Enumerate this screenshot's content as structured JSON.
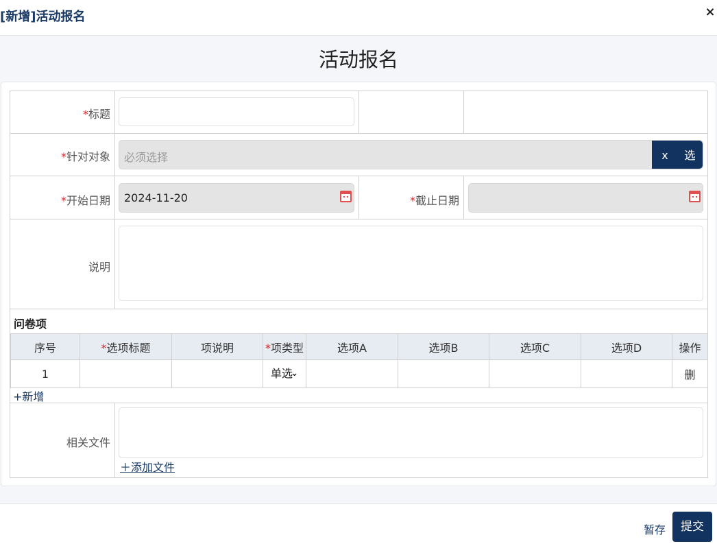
{
  "dialog": {
    "title": "[新增]活动报名",
    "close_label": "×"
  },
  "form": {
    "heading": "活动报名",
    "required_mark": "*",
    "fields": {
      "title": {
        "label": "标题",
        "value": ""
      },
      "target": {
        "label": "针对对象",
        "placeholder": "必须选择",
        "clear_label": "x",
        "select_label": "选"
      },
      "start_date": {
        "label": "开始日期",
        "value": "2024-11-20"
      },
      "end_date": {
        "label": "截止日期",
        "value": ""
      },
      "description": {
        "label": "说明",
        "value": ""
      },
      "files": {
        "label": "相关文件",
        "add_label": "＋添加文件"
      }
    },
    "questionnaire": {
      "title": "问卷项",
      "columns": [
        "序号",
        "选项标题",
        "项说明",
        "项类型",
        "选项A",
        "选项B",
        "选项C",
        "选项D",
        "操作"
      ],
      "required_columns": [
        "选项标题",
        "项类型"
      ],
      "rows": [
        {
          "index": "1",
          "option_title": "",
          "desc": "",
          "type": "单选",
          "a": "",
          "b": "",
          "c": "",
          "d": "",
          "action": "删"
        }
      ],
      "add_label": "+新增"
    }
  },
  "footer": {
    "draft_label": "暂存",
    "submit_label": "提交"
  },
  "colors": {
    "primary": "#12335f",
    "required": "#e02020",
    "header_bg": "#e7ecf3"
  }
}
